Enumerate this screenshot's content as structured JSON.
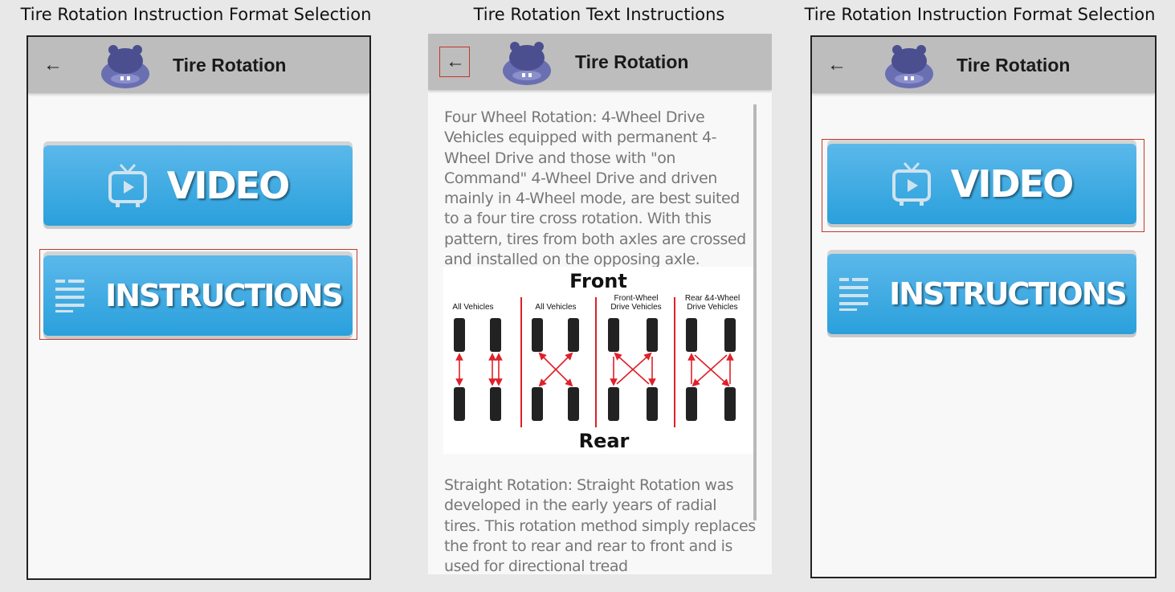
{
  "captions": {
    "left": "Tire Rotation Instruction Format Selection",
    "center": "Tire Rotation Text Instructions",
    "right": "Tire Rotation Instruction Format Selection"
  },
  "appbar": {
    "title": "Tire Rotation",
    "back_icon": "arrow-left-icon",
    "logo_icon": "hippo-icon"
  },
  "buttons": {
    "video_label": "VIDEO",
    "instructions_label": "INSTRUCTIONS",
    "video_icon": "tv-play-icon",
    "instructions_icon": "list-lines-icon"
  },
  "article": {
    "paragraph1": "Four Wheel Rotation: 4-Wheel Drive Vehicles equipped with permanent 4-Wheel Drive and those with \"on Command\" 4-Wheel Drive and driven mainly in 4-Wheel mode, are best suited to a four tire cross rotation. With this pattern, tires from both axles are crossed and installed on the opposing axle.",
    "paragraph2": "Straight Rotation: Straight Rotation was developed in the early years of radial tires. This rotation method simply replaces the front to rear and rear to front and is used for directional tread"
  },
  "diagram": {
    "top_label": "Front",
    "bottom_label": "Rear",
    "columns": [
      "All Vehicles",
      "All Vehicles",
      "Front-Wheel Drive Vehicles",
      "Rear &4-Wheel Drive Vehicles"
    ]
  },
  "colors": {
    "button": "#3aaae2",
    "appbar": "#bdbdbd",
    "highlight": "#c0392b",
    "arrows": "#e0202a"
  }
}
